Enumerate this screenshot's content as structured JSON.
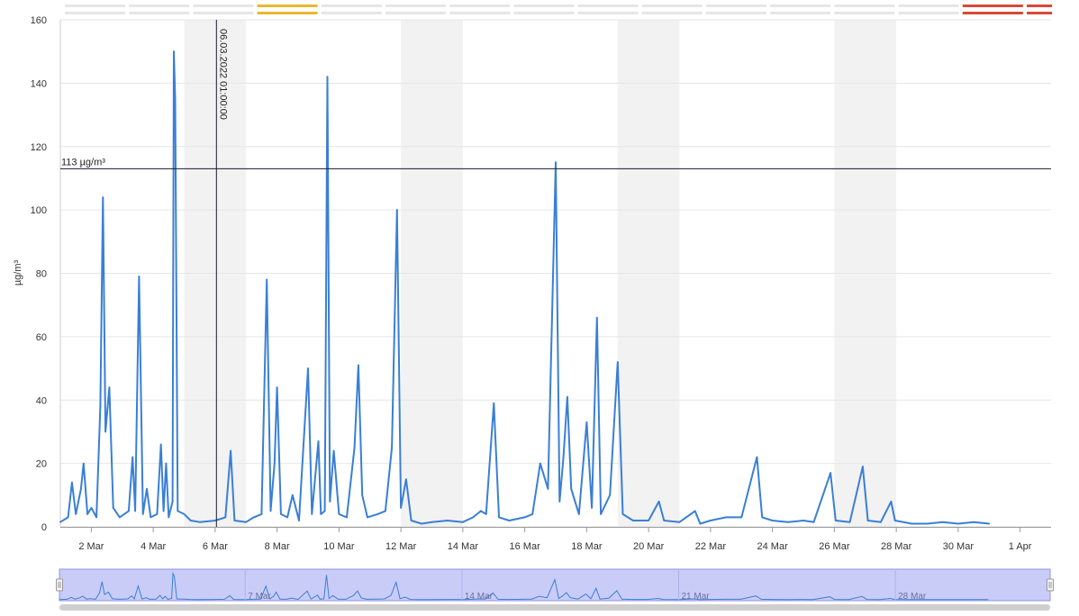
{
  "chart_data": {
    "type": "line",
    "title": "",
    "xlabel": "",
    "ylabel": "µg/m³",
    "ylim": [
      0,
      160
    ],
    "yticks": [
      0,
      20,
      40,
      60,
      80,
      100,
      120,
      140,
      160
    ],
    "xlim": [
      "2022-03-01",
      "2022-04-02"
    ],
    "xticks": [
      {
        "date": "2022-03-02",
        "label": "2 Mar"
      },
      {
        "date": "2022-03-04",
        "label": "4 Mar"
      },
      {
        "date": "2022-03-06",
        "label": "6 Mar"
      },
      {
        "date": "2022-03-08",
        "label": "8 Mar"
      },
      {
        "date": "2022-03-10",
        "label": "10 Mar"
      },
      {
        "date": "2022-03-12",
        "label": "12 Mar"
      },
      {
        "date": "2022-03-14",
        "label": "14 Mar"
      },
      {
        "date": "2022-03-16",
        "label": "16 Mar"
      },
      {
        "date": "2022-03-18",
        "label": "18 Mar"
      },
      {
        "date": "2022-03-20",
        "label": "20 Mar"
      },
      {
        "date": "2022-03-22",
        "label": "22 Mar"
      },
      {
        "date": "2022-03-24",
        "label": "24 Mar"
      },
      {
        "date": "2022-03-26",
        "label": "26 Mar"
      },
      {
        "date": "2022-03-28",
        "label": "28 Mar"
      },
      {
        "date": "2022-03-30",
        "label": "30 Mar"
      },
      {
        "date": "2022-04-01",
        "label": "1 Apr"
      }
    ],
    "grid": true,
    "weekend_bands": [
      [
        "2022-03-05",
        "2022-03-07"
      ],
      [
        "2022-03-12",
        "2022-03-14"
      ],
      [
        "2022-03-19",
        "2022-03-21"
      ],
      [
        "2022-03-26",
        "2022-03-28"
      ]
    ],
    "series": [
      {
        "color": "#3a7fd5",
        "points": [
          [
            "2022-03-01T00:00",
            1.5
          ],
          [
            "2022-03-01T06:00",
            3
          ],
          [
            "2022-03-01T09:00",
            14
          ],
          [
            "2022-03-01T12:00",
            4
          ],
          [
            "2022-03-01T16:00",
            12
          ],
          [
            "2022-03-01T18:00",
            20
          ],
          [
            "2022-03-01T21:00",
            4
          ],
          [
            "2022-03-02T00:00",
            6
          ],
          [
            "2022-03-02T04:00",
            3
          ],
          [
            "2022-03-02T07:00",
            38
          ],
          [
            "2022-03-02T09:00",
            104
          ],
          [
            "2022-03-02T11:00",
            30
          ],
          [
            "2022-03-02T14:00",
            44
          ],
          [
            "2022-03-02T17:00",
            6
          ],
          [
            "2022-03-02T22:00",
            3
          ],
          [
            "2022-03-03T05:00",
            5
          ],
          [
            "2022-03-03T08:00",
            22
          ],
          [
            "2022-03-03T10:00",
            5
          ],
          [
            "2022-03-03T13:00",
            79
          ],
          [
            "2022-03-03T16:00",
            4
          ],
          [
            "2022-03-03T19:00",
            12
          ],
          [
            "2022-03-03T22:00",
            3
          ],
          [
            "2022-03-04T03:00",
            4
          ],
          [
            "2022-03-04T06:00",
            26
          ],
          [
            "2022-03-04T08:00",
            5
          ],
          [
            "2022-03-04T10:00",
            20
          ],
          [
            "2022-03-04T12:00",
            3
          ],
          [
            "2022-03-04T15:00",
            8
          ],
          [
            "2022-03-04T16:00",
            150
          ],
          [
            "2022-03-04T17:00",
            135
          ],
          [
            "2022-03-04T19:00",
            5
          ],
          [
            "2022-03-05T00:00",
            4
          ],
          [
            "2022-03-05T05:00",
            2
          ],
          [
            "2022-03-05T12:00",
            1.5
          ],
          [
            "2022-03-06T00:00",
            2
          ],
          [
            "2022-03-06T08:00",
            3
          ],
          [
            "2022-03-06T12:00",
            24
          ],
          [
            "2022-03-06T15:00",
            2
          ],
          [
            "2022-03-07T00:00",
            1.5
          ],
          [
            "2022-03-07T06:00",
            3
          ],
          [
            "2022-03-07T12:00",
            4
          ],
          [
            "2022-03-07T16:00",
            78
          ],
          [
            "2022-03-07T19:00",
            5
          ],
          [
            "2022-03-07T22:00",
            20
          ],
          [
            "2022-03-08T00:00",
            44
          ],
          [
            "2022-03-08T03:00",
            4
          ],
          [
            "2022-03-08T08:00",
            3
          ],
          [
            "2022-03-08T12:00",
            10
          ],
          [
            "2022-03-08T17:00",
            2
          ],
          [
            "2022-03-09T00:00",
            50
          ],
          [
            "2022-03-09T03:00",
            4
          ],
          [
            "2022-03-09T08:00",
            27
          ],
          [
            "2022-03-09T10:00",
            4
          ],
          [
            "2022-03-09T13:00",
            5
          ],
          [
            "2022-03-09T15:00",
            142
          ],
          [
            "2022-03-09T17:00",
            8
          ],
          [
            "2022-03-09T20:00",
            24
          ],
          [
            "2022-03-10T00:00",
            4
          ],
          [
            "2022-03-10T06:00",
            3
          ],
          [
            "2022-03-10T12:00",
            25
          ],
          [
            "2022-03-10T15:00",
            51
          ],
          [
            "2022-03-10T18:00",
            10
          ],
          [
            "2022-03-10T22:00",
            3
          ],
          [
            "2022-03-11T06:00",
            4
          ],
          [
            "2022-03-11T12:00",
            5
          ],
          [
            "2022-03-11T17:00",
            25
          ],
          [
            "2022-03-11T21:00",
            100
          ],
          [
            "2022-03-12T00:00",
            6
          ],
          [
            "2022-03-12T04:00",
            15
          ],
          [
            "2022-03-12T08:00",
            2
          ],
          [
            "2022-03-12T16:00",
            1
          ],
          [
            "2022-03-13T00:00",
            1.5
          ],
          [
            "2022-03-13T12:00",
            2
          ],
          [
            "2022-03-14T00:00",
            1.5
          ],
          [
            "2022-03-14T08:00",
            3
          ],
          [
            "2022-03-14T14:00",
            5
          ],
          [
            "2022-03-14T18:00",
            4
          ],
          [
            "2022-03-15T00:00",
            39
          ],
          [
            "2022-03-15T04:00",
            3
          ],
          [
            "2022-03-15T12:00",
            2
          ],
          [
            "2022-03-16T00:00",
            3
          ],
          [
            "2022-03-16T06:00",
            4
          ],
          [
            "2022-03-16T12:00",
            20
          ],
          [
            "2022-03-16T18:00",
            12
          ],
          [
            "2022-03-17T00:00",
            115
          ],
          [
            "2022-03-17T03:00",
            8
          ],
          [
            "2022-03-17T06:00",
            22
          ],
          [
            "2022-03-17T09:00",
            41
          ],
          [
            "2022-03-17T12:00",
            12
          ],
          [
            "2022-03-17T18:00",
            4
          ],
          [
            "2022-03-18T00:00",
            33
          ],
          [
            "2022-03-18T04:00",
            6
          ],
          [
            "2022-03-18T08:00",
            66
          ],
          [
            "2022-03-18T11:00",
            4
          ],
          [
            "2022-03-18T18:00",
            10
          ],
          [
            "2022-03-19T00:00",
            52
          ],
          [
            "2022-03-19T04:00",
            4
          ],
          [
            "2022-03-19T12:00",
            2
          ],
          [
            "2022-03-20T00:00",
            2
          ],
          [
            "2022-03-20T08:00",
            8
          ],
          [
            "2022-03-20T12:00",
            2
          ],
          [
            "2022-03-21T00:00",
            1.5
          ],
          [
            "2022-03-21T12:00",
            5
          ],
          [
            "2022-03-21T16:00",
            1
          ],
          [
            "2022-03-22T00:00",
            2
          ],
          [
            "2022-03-22T12:00",
            3
          ],
          [
            "2022-03-23T00:00",
            3
          ],
          [
            "2022-03-23T12:00",
            22
          ],
          [
            "2022-03-23T16:00",
            3
          ],
          [
            "2022-03-24T00:00",
            2
          ],
          [
            "2022-03-24T12:00",
            1.5
          ],
          [
            "2022-03-25T00:00",
            2
          ],
          [
            "2022-03-25T08:00",
            1.5
          ],
          [
            "2022-03-25T21:00",
            17
          ],
          [
            "2022-03-26T01:00",
            2
          ],
          [
            "2022-03-26T12:00",
            1.5
          ],
          [
            "2022-03-26T22:00",
            19
          ],
          [
            "2022-03-27T02:00",
            2
          ],
          [
            "2022-03-27T12:00",
            1.5
          ],
          [
            "2022-03-27T20:00",
            8
          ],
          [
            "2022-03-27T23:00",
            2
          ],
          [
            "2022-03-28T12:00",
            1
          ],
          [
            "2022-03-29T00:00",
            1
          ],
          [
            "2022-03-29T12:00",
            1.5
          ],
          [
            "2022-03-30T00:00",
            1
          ],
          [
            "2022-03-30T12:00",
            1.5
          ],
          [
            "2022-03-31T00:00",
            1
          ]
        ]
      }
    ],
    "annotations": [
      {
        "type": "horizontal-line",
        "value": 113,
        "label": "113 µg/m³"
      },
      {
        "type": "vertical-line",
        "date": "2022-03-06T01:00",
        "label": "06.03.2022 01:00:00"
      }
    ],
    "status_bar": {
      "colors": [
        "#e6e6e6",
        "#e6e6e6",
        "#e6e6e6",
        "#e8b92e",
        "#e6e6e6",
        "#e6e6e6",
        "#e6e6e6",
        "#e6e6e6",
        "#e6e6e6",
        "#e6e6e6",
        "#e6e6e6",
        "#e6e6e6",
        "#e6e6e6",
        "#e6e6e6",
        "#d64a38",
        "#d64a38"
      ]
    },
    "navigator": {
      "labels": [
        {
          "date": "2022-03-07",
          "label": "7 Mar"
        },
        {
          "date": "2022-03-14",
          "label": "14 Mar"
        },
        {
          "date": "2022-03-21",
          "label": "21 Mar"
        },
        {
          "date": "2022-03-28",
          "label": "28 Mar"
        }
      ]
    }
  }
}
